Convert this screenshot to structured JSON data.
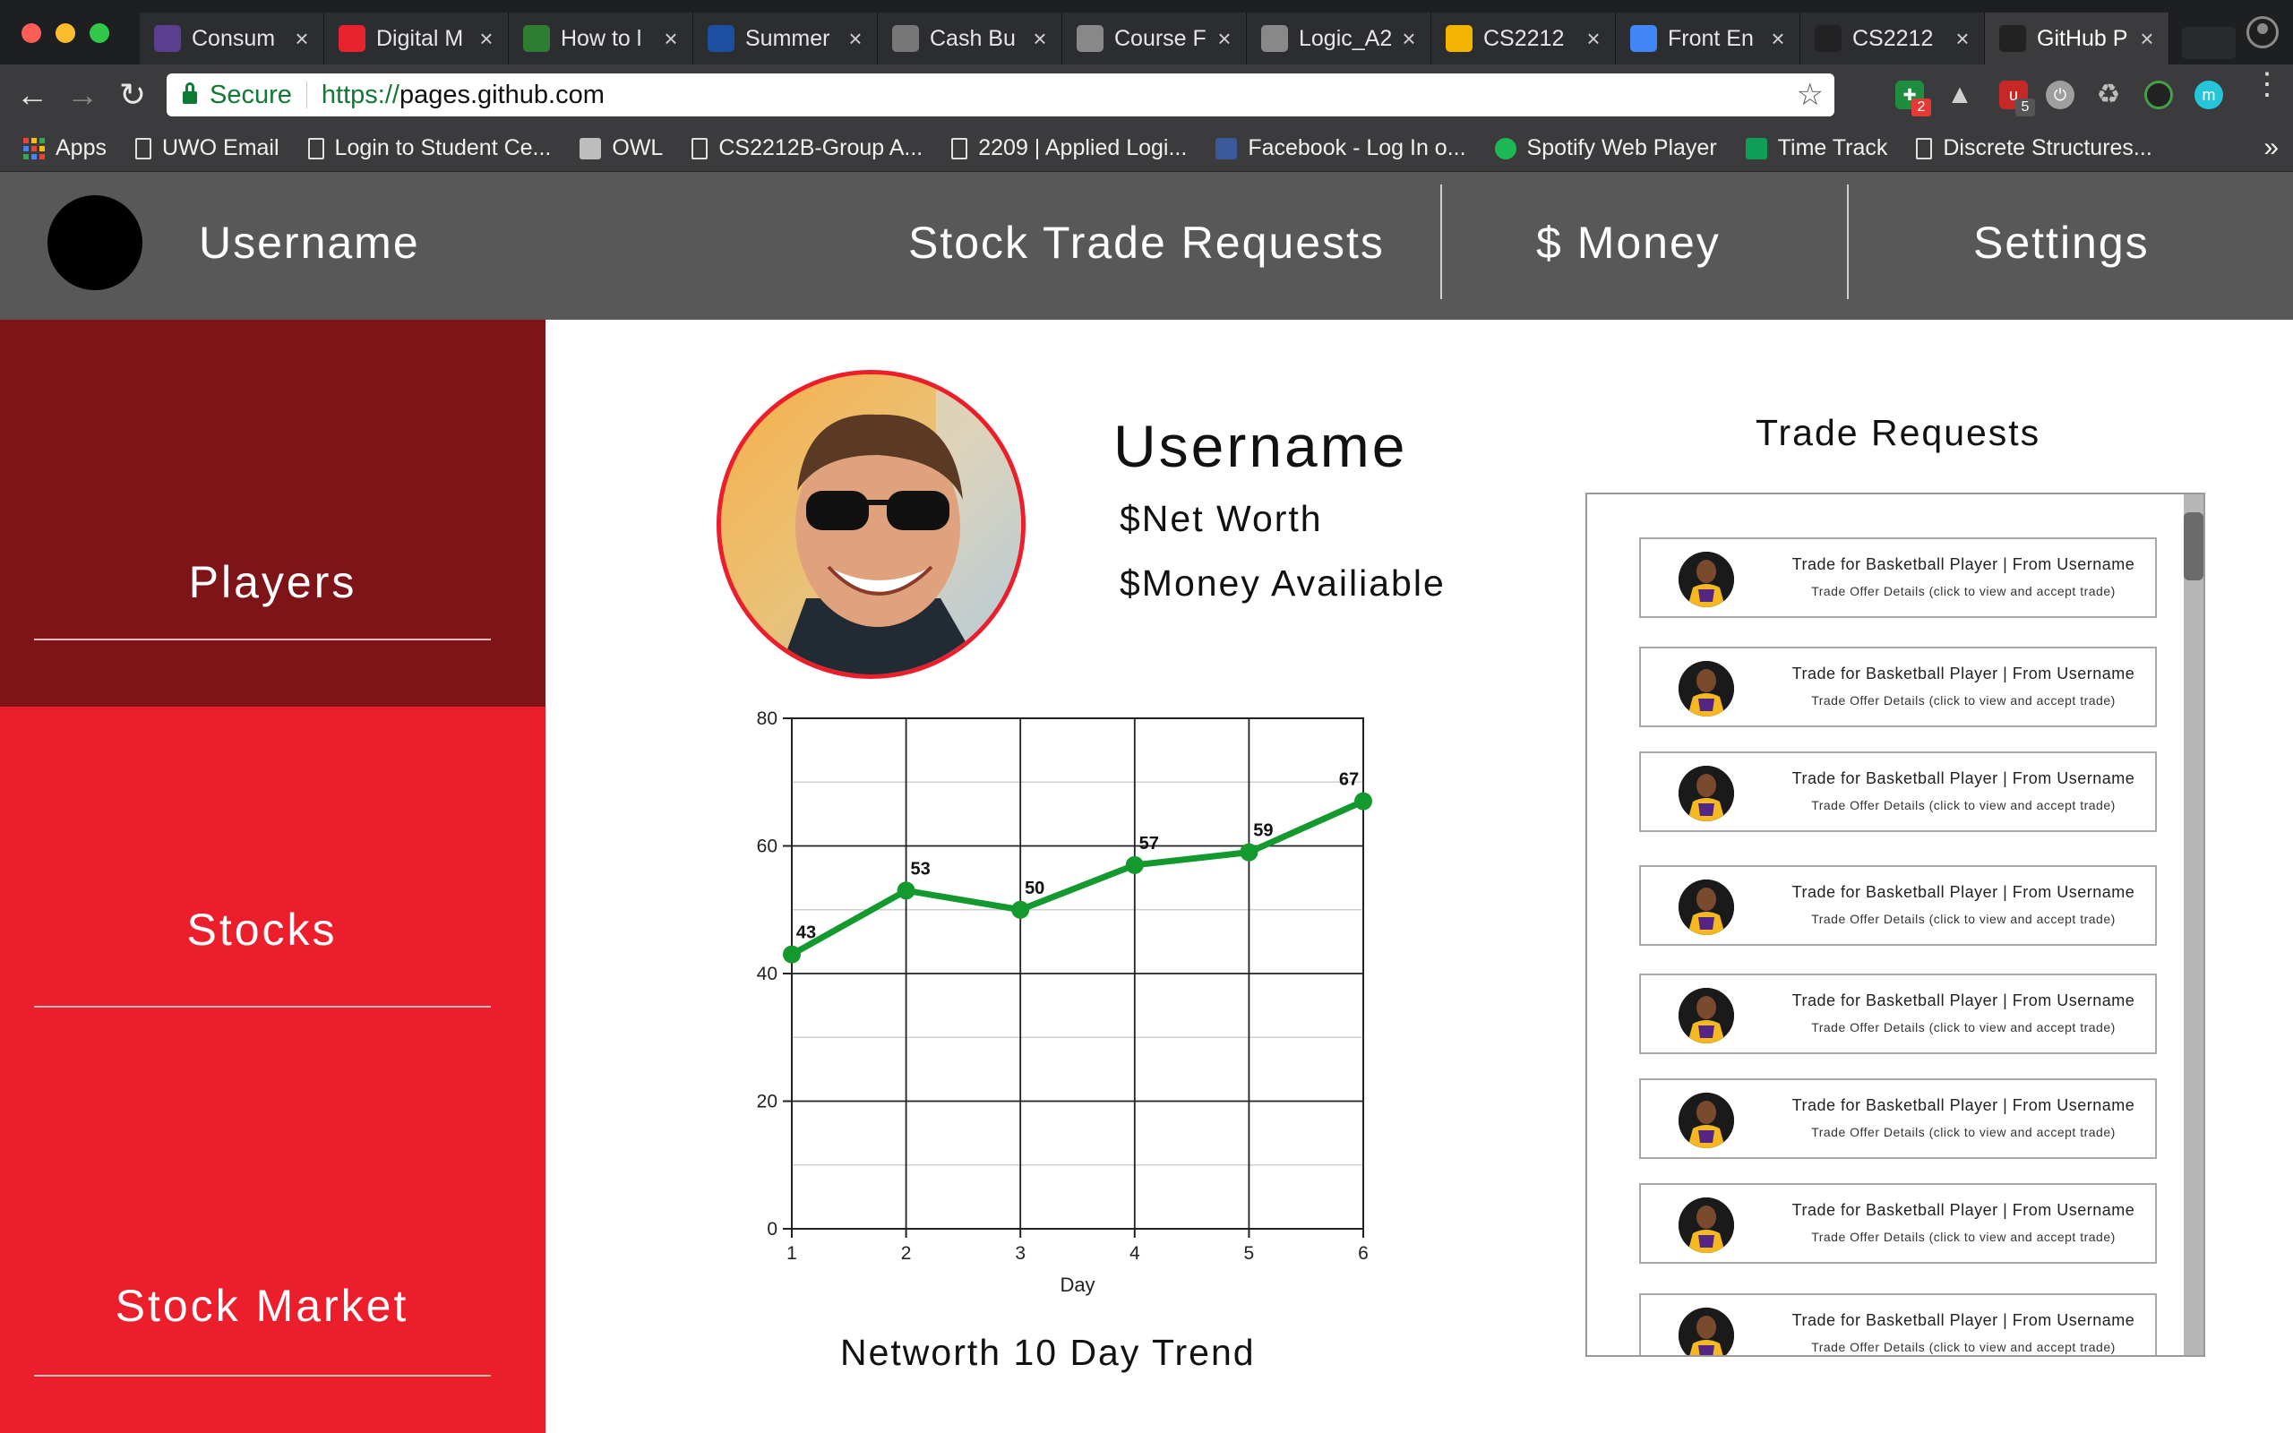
{
  "browser": {
    "tabs": [
      {
        "title": "Consum",
        "icon": "shield-icon",
        "color": "#5b3f8f"
      },
      {
        "title": "Digital M",
        "icon": "red-logo-icon",
        "color": "#e8232d"
      },
      {
        "title": "How to l",
        "icon": "code-icon",
        "color": "#2f7d32"
      },
      {
        "title": "Summer",
        "icon": "bank-icon",
        "color": "#1c4fa0"
      },
      {
        "title": "Cash Bu",
        "icon": "animal-icon",
        "color": "#777777"
      },
      {
        "title": "Course F",
        "icon": "doc-icon",
        "color": "#888888"
      },
      {
        "title": "Logic_A2",
        "icon": "doc-icon",
        "color": "#888888"
      },
      {
        "title": "CS2212",
        "icon": "drive-icon",
        "color": "#f2b400"
      },
      {
        "title": "Front En",
        "icon": "docs-icon",
        "color": "#4285f4"
      },
      {
        "title": "CS2212",
        "icon": "github-icon",
        "color": "#222222"
      },
      {
        "title": "GitHub P",
        "icon": "github-icon",
        "color": "#222222"
      }
    ],
    "close_glyph": "×",
    "secure_label": "Secure",
    "url_scheme": "https://",
    "url_host": "pages.github.com",
    "extension_badges": [
      "2",
      "5"
    ],
    "bookmarks": [
      {
        "label": "Apps",
        "icon": "apps-icon"
      },
      {
        "label": "UWO Email",
        "icon": "doc-icon"
      },
      {
        "label": "Login to Student Ce...",
        "icon": "doc-icon"
      },
      {
        "label": "OWL",
        "icon": "owl-icon"
      },
      {
        "label": "CS2212B-Group A...",
        "icon": "doc-icon"
      },
      {
        "label": "2209 | Applied Logi...",
        "icon": "doc-icon"
      },
      {
        "label": "Facebook - Log In o...",
        "icon": "facebook-icon"
      },
      {
        "label": "Spotify Web Player",
        "icon": "spotify-icon"
      },
      {
        "label": "Time Track",
        "icon": "sheets-icon"
      },
      {
        "label": "Discrete Structures...",
        "icon": "doc-icon"
      }
    ],
    "more_glyph": "»"
  },
  "header": {
    "username": "Username",
    "nav": {
      "stock_trade_requests": "Stock Trade Requests",
      "money": "$ Money",
      "settings": "Settings"
    }
  },
  "sidebar": {
    "items": [
      {
        "label": "Players"
      },
      {
        "label": "Stocks"
      },
      {
        "label": "Stock Market"
      }
    ]
  },
  "profile": {
    "name": "Username",
    "net_worth": "$Net Worth",
    "money_available": "$Money Availiable"
  },
  "chart_data": {
    "type": "line",
    "title": "Networth 10 Day Trend",
    "xlabel": "Day",
    "ylabel": "",
    "x": [
      1,
      2,
      3,
      4,
      5,
      6
    ],
    "values": [
      43,
      53,
      50,
      57,
      59,
      67
    ],
    "ylim": [
      0,
      80
    ],
    "yticks": [
      0,
      20,
      40,
      60,
      80
    ],
    "grid": true,
    "color": "#14992e"
  },
  "trade_requests": {
    "title": "Trade Requests",
    "items": [
      {
        "title": "Trade for Basketball Player | From Username",
        "detail": "Trade Offer Details (click to view and accept trade)"
      },
      {
        "title": "Trade for Basketball Player | From Username",
        "detail": "Trade Offer Details (click to view and accept trade)"
      },
      {
        "title": "Trade for Basketball Player | From Username",
        "detail": "Trade Offer Details (click to view and accept trade)"
      },
      {
        "title": "Trade for Basketball Player | From Username",
        "detail": "Trade Offer Details (click to view and accept trade)"
      },
      {
        "title": "Trade for Basketball Player | From Username",
        "detail": "Trade Offer Details (click to view and accept trade)"
      },
      {
        "title": "Trade for Basketball Player | From Username",
        "detail": "Trade Offer Details (click to view and accept trade)"
      },
      {
        "title": "Trade for Basketball Player | From Username",
        "detail": "Trade Offer Details (click to view and accept trade)"
      },
      {
        "title": "Trade for Basketball Player | From Username",
        "detail": "Trade Offer Details (click to view and accept trade)"
      }
    ]
  }
}
